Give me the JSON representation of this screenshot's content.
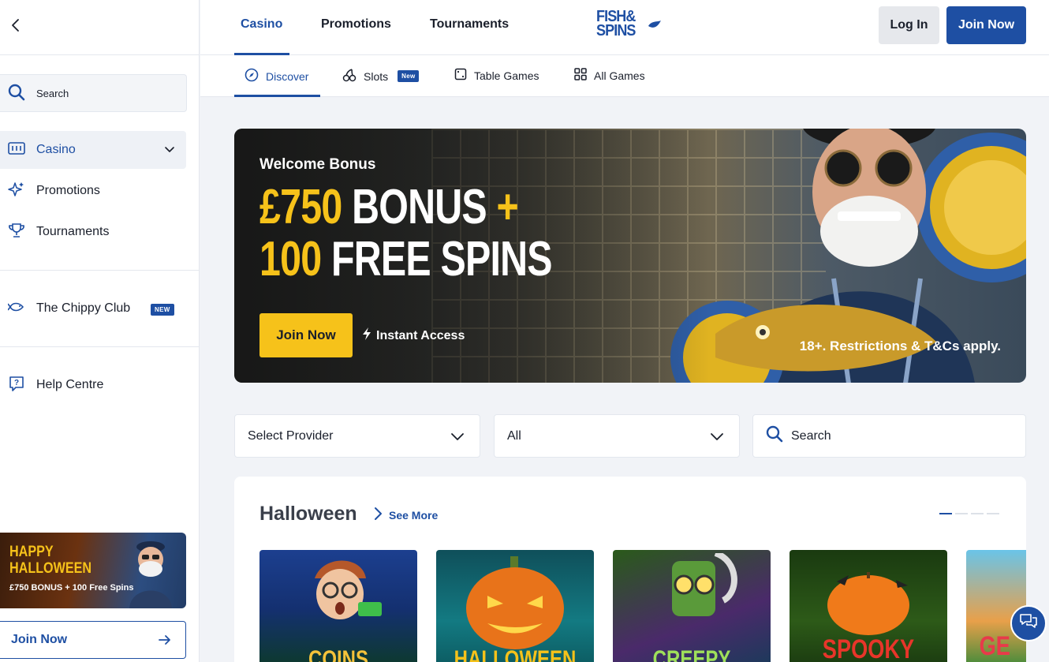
{
  "sidebar": {
    "search_placeholder": "Search",
    "items": [
      {
        "label": "Casino"
      },
      {
        "label": "Promotions"
      },
      {
        "label": "Tournaments"
      },
      {
        "label": "The Chippy Club",
        "badge": "NEW"
      },
      {
        "label": "Help Centre"
      }
    ],
    "promo": {
      "headline_1": "HAPPY",
      "headline_2": "HALLOWEEN",
      "sub": "£750 BONUS + 100 Free Spins"
    },
    "join_label": "Join Now"
  },
  "header": {
    "tabs": [
      {
        "label": "Casino"
      },
      {
        "label": "Promotions"
      },
      {
        "label": "Tournaments"
      }
    ],
    "logo_1": "FISH&",
    "logo_2": "SPINS",
    "login_label": "Log In",
    "join_label": "Join Now"
  },
  "subnav": {
    "items": [
      {
        "label": "Discover"
      },
      {
        "label": "Slots",
        "badge": "New"
      },
      {
        "label": "Table Games"
      },
      {
        "label": "All Games"
      }
    ]
  },
  "hero": {
    "welcome": "Welcome Bonus",
    "line1_yellow": "£750",
    "line1_white": "BONUS",
    "line1_plus": "+",
    "line2_yellow": "100",
    "line2_white": "FREE SPINS",
    "cta": "Join Now",
    "instant": "Instant Access",
    "terms": "18+. Restrictions & T&Cs apply."
  },
  "filters": {
    "provider": "Select Provider",
    "category": "All",
    "search_placeholder": "Search"
  },
  "section": {
    "title": "Halloween",
    "see_more": "See More",
    "games": [
      {
        "title": "COINS"
      },
      {
        "title": "HALLOWEEN"
      },
      {
        "title": "CREEPY"
      },
      {
        "title": "SPOOKY"
      },
      {
        "title": "GE"
      }
    ]
  },
  "colors": {
    "brand": "#1e4fa3",
    "accent": "#f6c21a"
  }
}
